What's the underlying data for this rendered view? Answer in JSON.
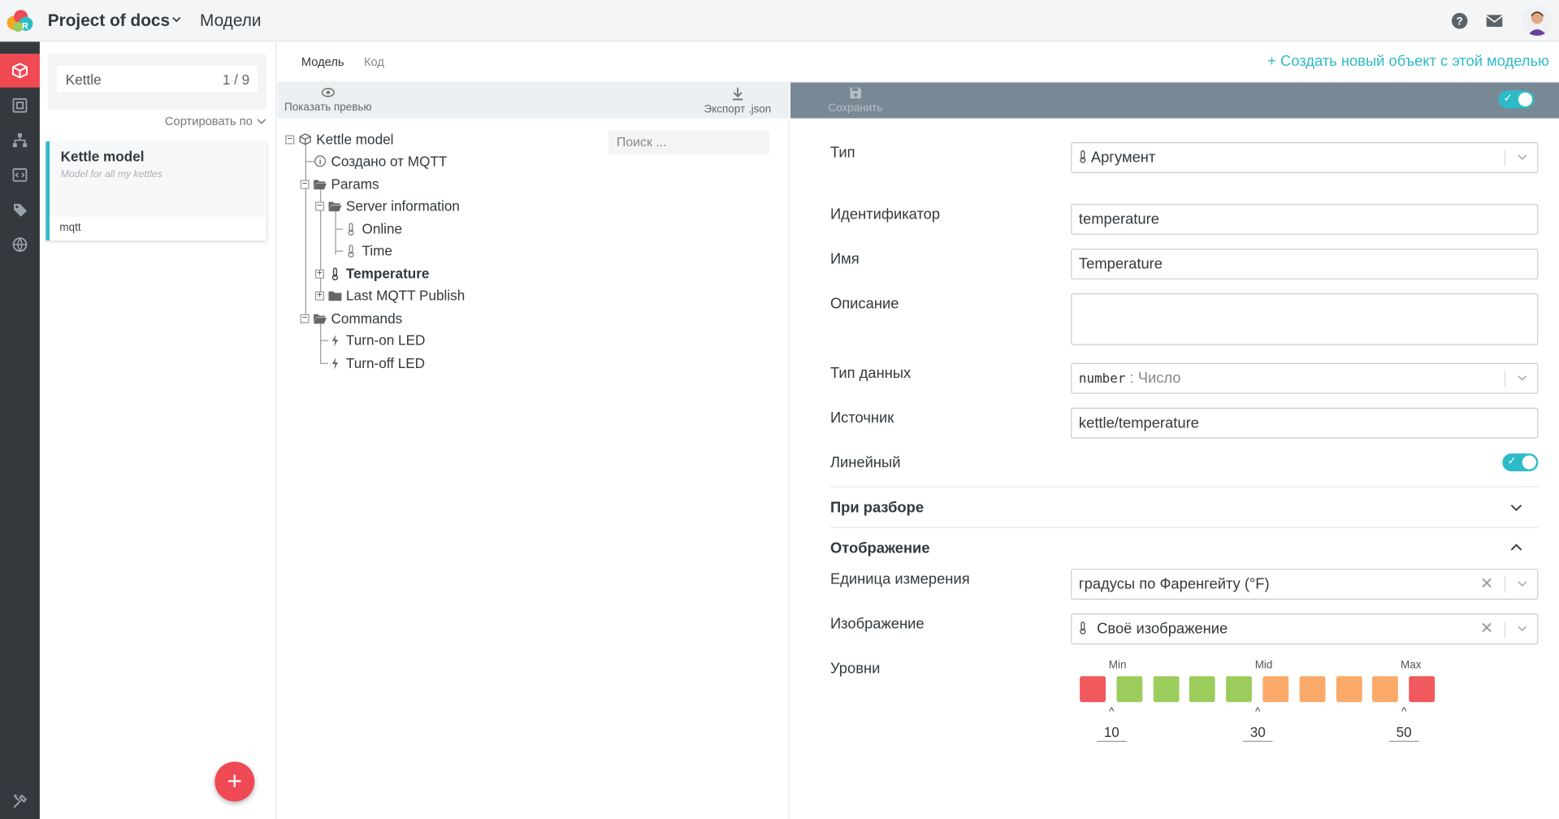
{
  "header": {
    "project": "Project of docs",
    "page_title": "Модели"
  },
  "list": {
    "search_value": "Kettle",
    "search_count": "1 / 9",
    "sort_label": "Сортировать по",
    "card": {
      "title": "Kettle model",
      "description": "Model for all my kettles",
      "tag": "mqtt"
    }
  },
  "tabs": {
    "model": "Модель",
    "code": "Код"
  },
  "create_link": "+ Создать новый объект с этой моделью",
  "toolbar": {
    "preview": "Показать превью",
    "export": "Экспорт .json",
    "save": "Сохранить"
  },
  "tree": {
    "search_placeholder": "Поиск ...",
    "root": "Kettle model",
    "created": "Создано от MQTT",
    "params": "Params",
    "server_info": "Server information",
    "online": "Online",
    "time": "Time",
    "temperature": "Temperature",
    "last_publish": "Last MQTT Publish",
    "commands": "Commands",
    "turn_on": "Turn-on LED",
    "turn_off": "Turn-off LED"
  },
  "form": {
    "type_label": "Тип",
    "type_value": "Аргумент",
    "id_label": "Идентификатор",
    "id_value": "temperature",
    "name_label": "Имя",
    "name_value": "Temperature",
    "desc_label": "Описание",
    "datatype_label": "Тип данных",
    "datatype_code": "number",
    "datatype_value": ": Число",
    "source_label": "Источник",
    "source_value": "kettle/temperature",
    "linear_label": "Линейный",
    "parsing_section": "При разборе",
    "display_section": "Отображение",
    "unit_label": "Единица измерения",
    "unit_value": "градусы по Фаренгейту (°F)",
    "image_label": "Изображение",
    "image_value": "Своё изображение",
    "levels_label": "Уровни",
    "levels": {
      "min_label": "Min",
      "mid_label": "Mid",
      "max_label": "Max",
      "min_value": "10",
      "mid_value": "30",
      "max_value": "50",
      "colors": [
        "#f0595d",
        "#9ccc5c",
        "#9ccc5c",
        "#9ccc5c",
        "#9ccc5c",
        "#fba968",
        "#fba968",
        "#fba968",
        "#fba968",
        "#f0595d"
      ]
    }
  }
}
